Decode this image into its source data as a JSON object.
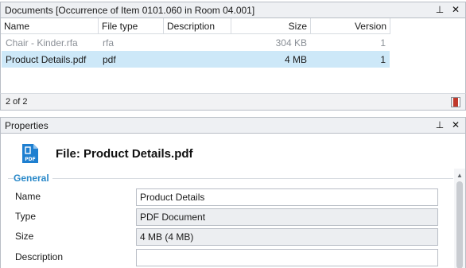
{
  "documents_pane": {
    "title": "Documents [Occurrence of Item 0101.060 in Room 04.001]",
    "pin_glyph": "⊥",
    "close_glyph": "✕",
    "columns": [
      "Name",
      "File type",
      "Description",
      "Size",
      "Version"
    ],
    "rows": [
      {
        "name": "Chair - Kinder.rfa",
        "type": "rfa",
        "description": "",
        "size": "304 KB",
        "version": "1"
      },
      {
        "name": "Product Details.pdf",
        "type": "pdf",
        "description": "",
        "size": "4 MB",
        "version": "1"
      }
    ],
    "status": "2 of 2",
    "colors": {
      "selected_row": "#cde8f8",
      "accent": "#2a89c9"
    }
  },
  "properties_pane": {
    "title": "Properties",
    "pin_glyph": "⊥",
    "close_glyph": "✕",
    "file_icon_label": "PDF",
    "file_title": "File: Product Details.pdf",
    "group": "General",
    "fields": [
      {
        "label": "Name",
        "value": "Product Details"
      },
      {
        "label": "Type",
        "value": "PDF Document"
      },
      {
        "label": "Size",
        "value": "4 MB (4 MB)"
      },
      {
        "label": "Description",
        "value": ""
      }
    ]
  }
}
